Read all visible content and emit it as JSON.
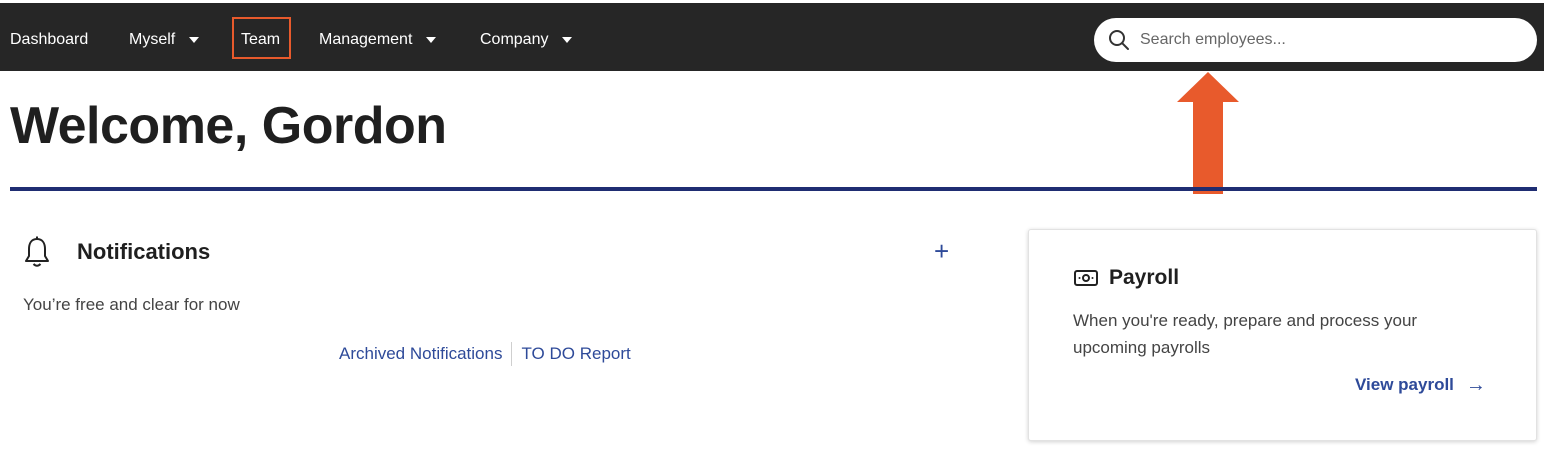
{
  "nav": {
    "items": [
      {
        "label": "Dashboard",
        "has_caret": false
      },
      {
        "label": "Myself",
        "has_caret": true
      },
      {
        "label": "Team",
        "has_caret": false,
        "highlighted": true
      },
      {
        "label": "Management",
        "has_caret": true
      },
      {
        "label": "Company",
        "has_caret": true
      }
    ],
    "search": {
      "placeholder": "Search employees...",
      "value": "",
      "icon": "search-icon"
    }
  },
  "page": {
    "title": "Welcome, Gordon"
  },
  "notifications": {
    "title": "Notifications",
    "icon": "bell-icon",
    "add_label": "+",
    "empty_text": "You’re free and clear for now",
    "links": [
      "Archived Notifications",
      "TO DO Report"
    ]
  },
  "payroll_card": {
    "icon": "money-icon",
    "title": "Payroll",
    "description": "When you're ready, prepare and process your upcoming payrolls",
    "link_label": "View payroll",
    "link_arrow": "→"
  },
  "colors": {
    "nav_bg": "#262626",
    "accent_blue": "#2e4a99",
    "rule_navy": "#1f2d72",
    "annotation_orange": "#e85a2c"
  }
}
